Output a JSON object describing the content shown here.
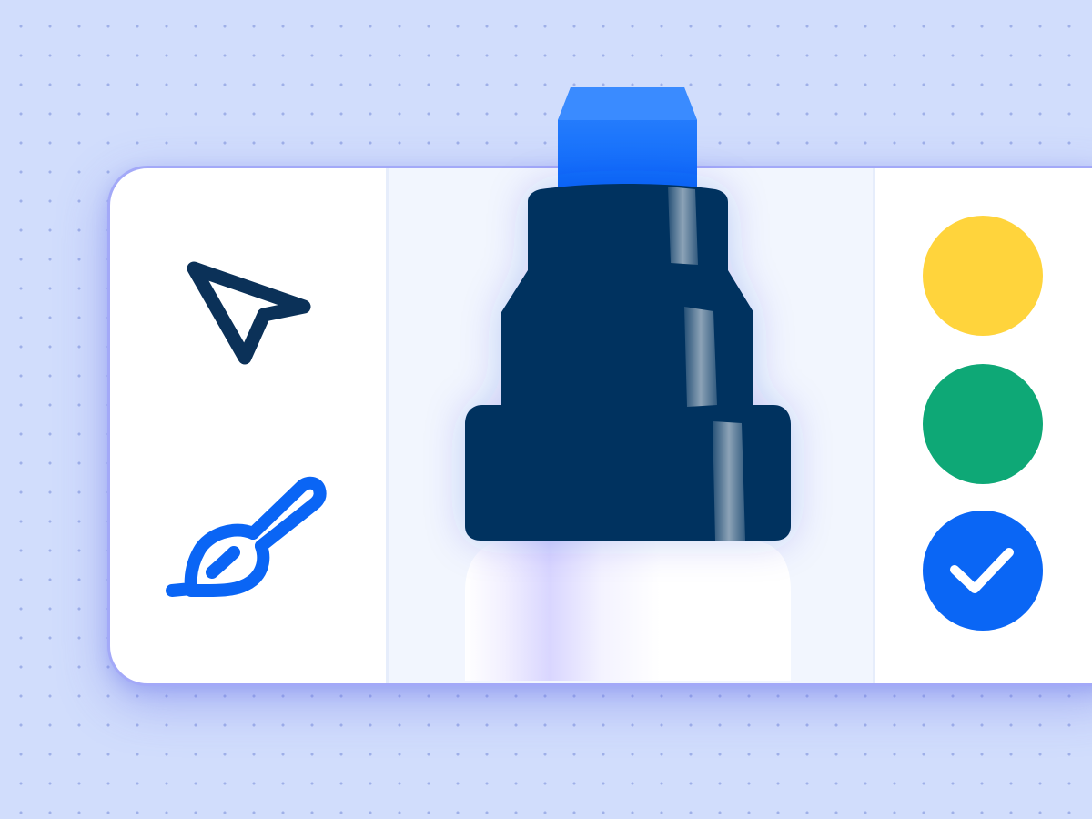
{
  "tools": [
    {
      "name": "select",
      "icon": "cursor-arrow-icon",
      "color": "#0b3158"
    },
    {
      "name": "brush",
      "icon": "paintbrush-icon",
      "color": "#0a65f5",
      "selected": true
    }
  ],
  "marker": {
    "icon": "marker-pen-icon",
    "tip_color": "#0a66f8",
    "cap_color": "#02325f",
    "body_color": "#ffffff"
  },
  "colors": [
    {
      "name": "yellow",
      "hex": "#ffd43c",
      "selected": false
    },
    {
      "name": "green",
      "hex": "#0ea876",
      "selected": false
    },
    {
      "name": "blue",
      "hex": "#0a66f5",
      "selected": true,
      "icon": "checkmark-icon"
    }
  ],
  "theme": {
    "background": "#d1ddfc",
    "toolbar_border": "#a3a9f8"
  }
}
